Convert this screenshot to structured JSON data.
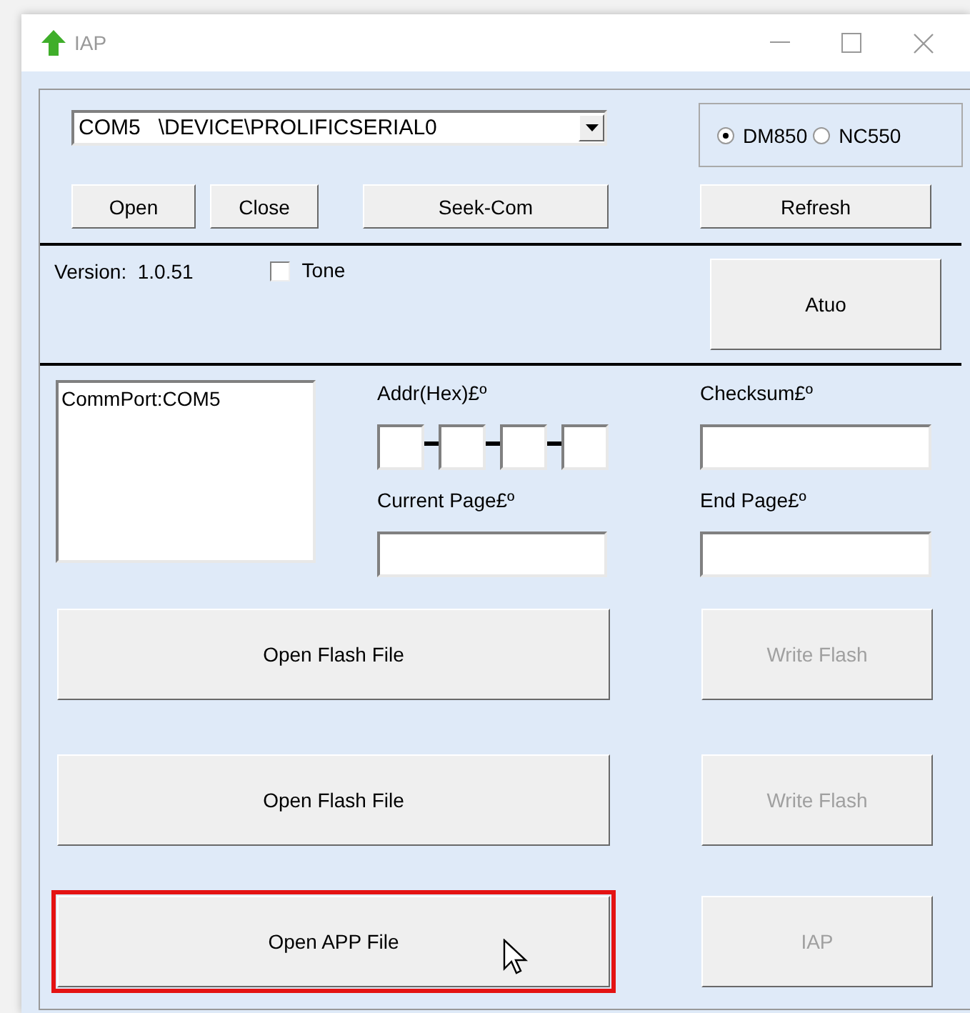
{
  "window": {
    "title": "IAP"
  },
  "port": {
    "value": "COM5   \\DEVICE\\PROLIFICSERIAL0"
  },
  "models": [
    {
      "label": "DM850",
      "selected": true
    },
    {
      "label": "NC550",
      "selected": false
    }
  ],
  "port_buttons": [
    {
      "label": "Open"
    },
    {
      "label": "Close"
    },
    {
      "label": "Seek-Com"
    }
  ],
  "refresh_button": "Refresh",
  "version": "Version:  1.0.51",
  "tone": {
    "label": "Tone",
    "checked": false
  },
  "auto_button": "Atuo",
  "log": [
    "CommPort:COM5"
  ],
  "addr": {
    "label": "Addr(Hex)£º"
  },
  "checksum": {
    "label": "Checksum£º"
  },
  "current_page": {
    "label": "Current Page£º"
  },
  "end_page": {
    "label": "End Page£º"
  },
  "actions": [
    {
      "open": {
        "label": "Open Flash File",
        "highlighted": false
      },
      "write": {
        "label": "Write Flash",
        "disabled": true
      }
    },
    {
      "open": {
        "label": "Open Flash File",
        "highlighted": false
      },
      "write": {
        "label": "Write Flash",
        "disabled": true
      }
    },
    {
      "open": {
        "label": "Open APP File",
        "highlighted": true
      },
      "write": {
        "label": "IAP",
        "disabled": true
      }
    }
  ]
}
